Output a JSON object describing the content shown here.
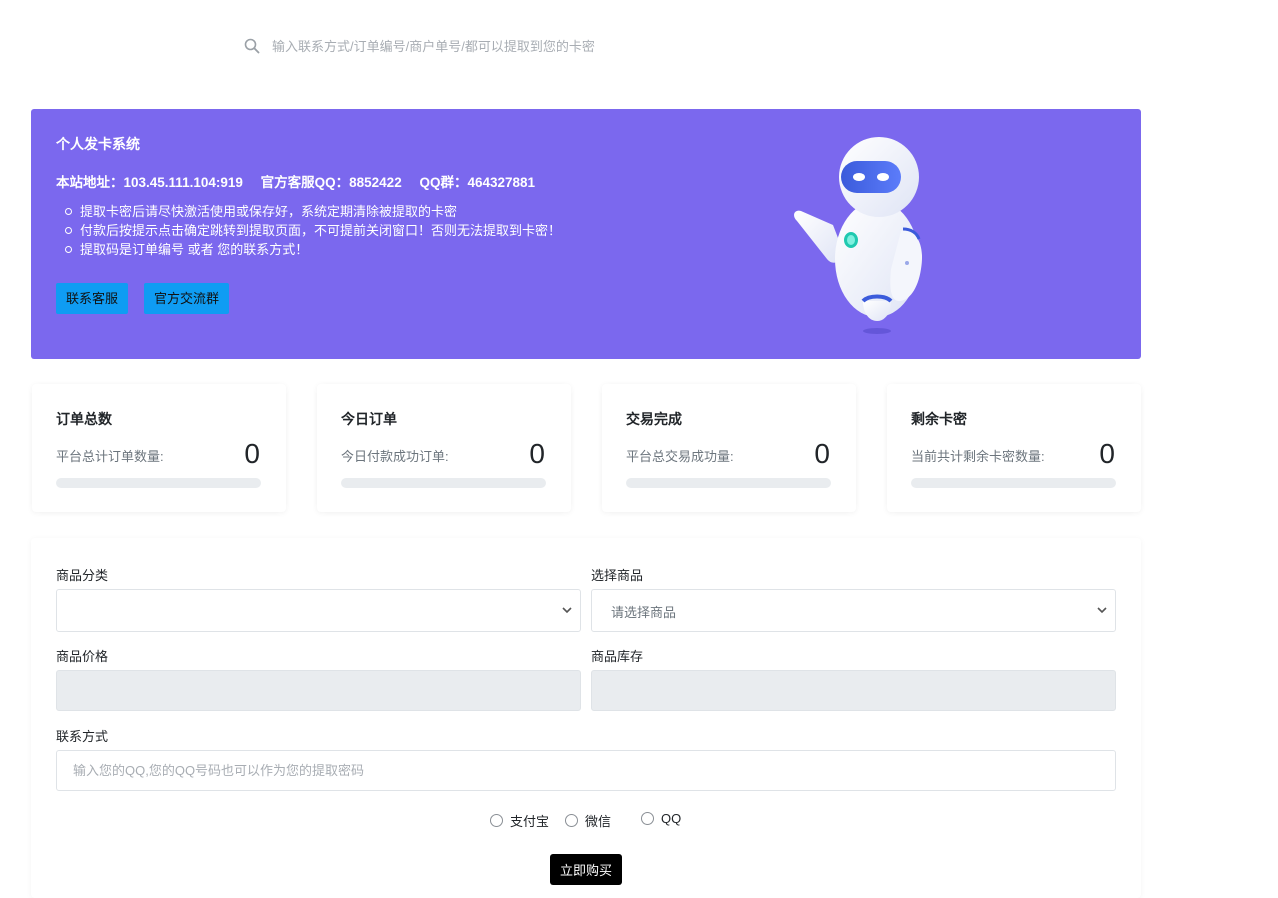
{
  "search": {
    "placeholder": "输入联系方式/订单编号/商户单号/都可以提取到您的卡密",
    "icon": "search-icon"
  },
  "hero": {
    "title": "个人发卡系统",
    "site_label": "本站地址：103.45.111.104:919",
    "service_label": "官方客服QQ：8852422",
    "group_label": "QQ群：464327881",
    "notes": [
      "提取卡密后请尽快激活使用或保存好，系统定期清除被提取的卡密",
      "付款后按提示点击确定跳转到提取页面，不可提前关闭窗口！否则无法提取到卡密！",
      "提取码是订单编号 或者 您的联系方式！"
    ],
    "btn_contact": "联系客服",
    "btn_group": "官方交流群",
    "bg_color": "#7b68ee",
    "btn_color": "#0f9cf3",
    "illustration": "robot-illustration"
  },
  "stats": [
    {
      "title": "订单总数",
      "label": "平台总计订单数量:",
      "value": "0",
      "progress": 0
    },
    {
      "title": "今日订单",
      "label": "今日付款成功订单:",
      "value": "0",
      "progress": 0
    },
    {
      "title": "交易完成",
      "label": "平台总交易成功量:",
      "value": "0",
      "progress": 0
    },
    {
      "title": "剩余卡密",
      "label": "当前共计剩余卡密数量:",
      "value": "0",
      "progress": 0
    }
  ],
  "form": {
    "category_label": "商品分类",
    "category_value": "",
    "product_label": "选择商品",
    "product_value": "请选择商品",
    "price_label": "商品价格",
    "price_value": "",
    "stock_label": "商品库存",
    "stock_value": "",
    "contact_label": "联系方式",
    "contact_placeholder": "输入您的QQ,您的QQ号码也可以作为您的提取密码",
    "pay_methods": [
      "支付宝",
      "微信",
      "QQ"
    ],
    "buy_label": "立即购买"
  }
}
